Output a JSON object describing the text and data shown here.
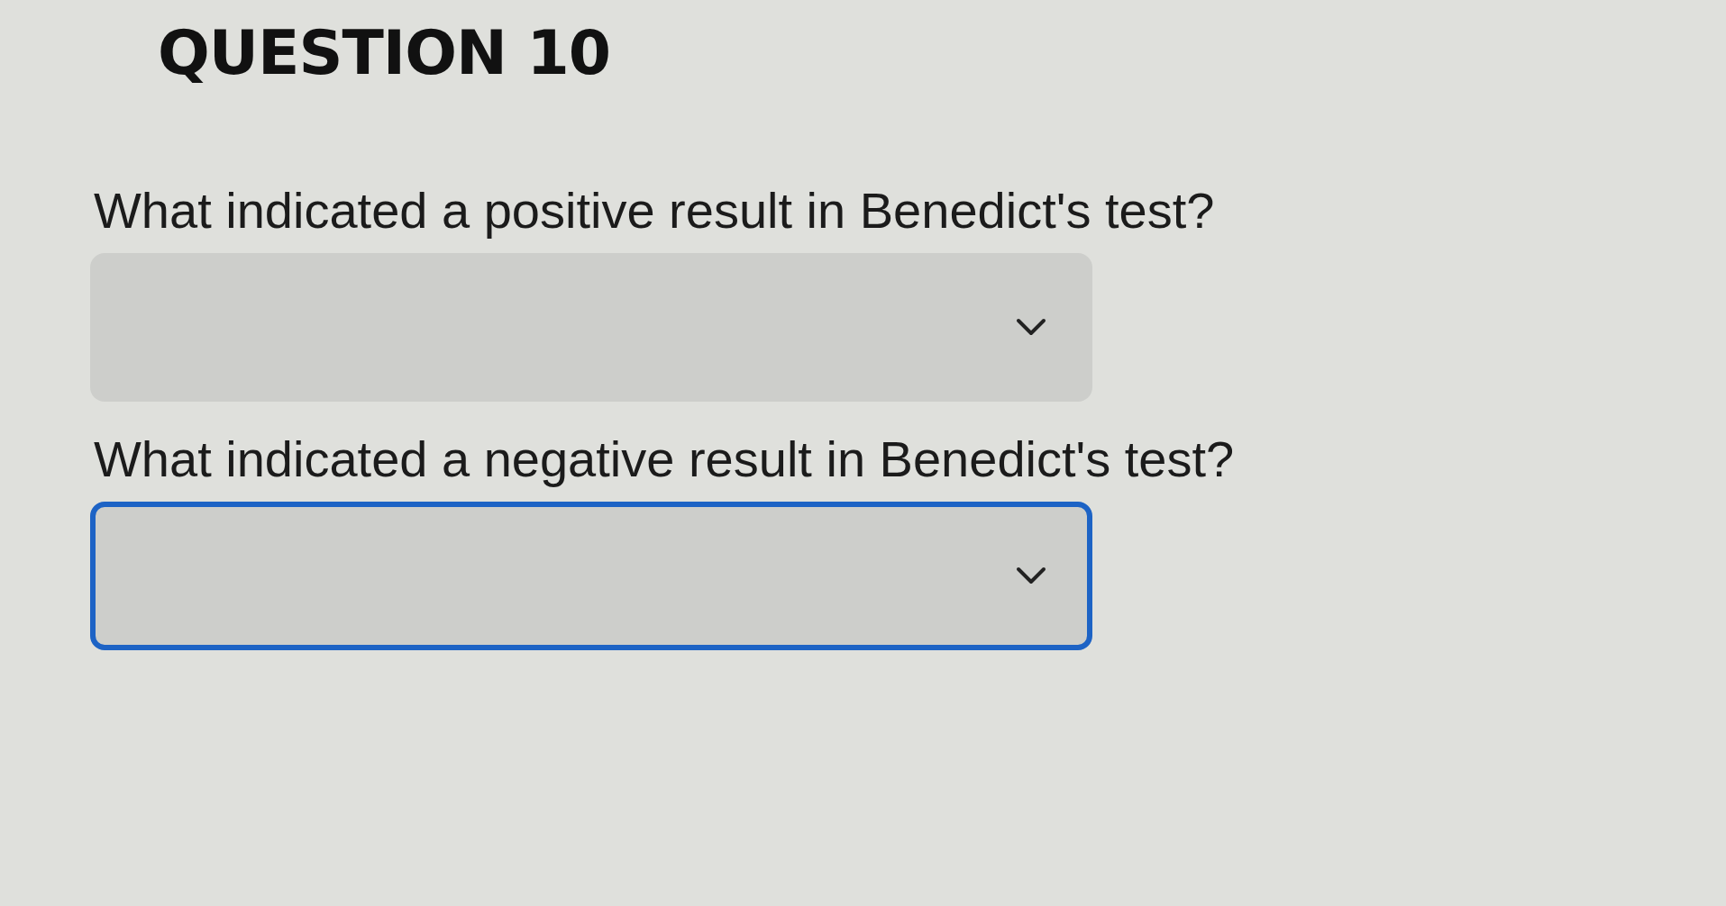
{
  "heading": "QUESTION 10",
  "questions": [
    {
      "prompt": "What indicated a positive result in Benedict's test?",
      "focused": false
    },
    {
      "prompt": "What indicated a negative result in Benedict's test?",
      "focused": true
    }
  ]
}
